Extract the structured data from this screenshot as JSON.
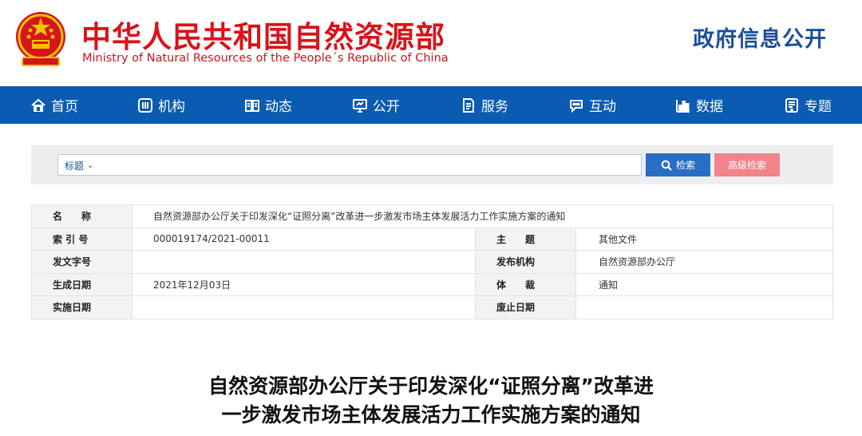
{
  "header": {
    "title": "中华人民共和国自然资源部",
    "subtitle": "Ministry of Natural Resources of the People´s Republic of China",
    "gov_info": "政府信息公开",
    "emblem_icon": "national-emblem-icon"
  },
  "nav": {
    "items": [
      {
        "label": "首页",
        "icon": "home-icon"
      },
      {
        "label": "机构",
        "icon": "org-icon"
      },
      {
        "label": "动态",
        "icon": "book-icon"
      },
      {
        "label": "公开",
        "icon": "monitor-icon"
      },
      {
        "label": "服务",
        "icon": "document-icon"
      },
      {
        "label": "互动",
        "icon": "chat-icon"
      },
      {
        "label": "数据",
        "icon": "bar-chart-icon"
      },
      {
        "label": "专题",
        "icon": "tablet-icon"
      }
    ]
  },
  "search": {
    "type_label": "标题",
    "placeholder": "",
    "search_button": "检索",
    "advanced_button": "高级检索"
  },
  "info": {
    "name_label": "名　　称",
    "name_value": "自然资源部办公厅关于印发深化“证照分离”改革进一步激发市场主体发展活力工作实施方案的通知",
    "index_label": "索 引 号",
    "index_value": "000019174/2021-00011",
    "topic_label": "主　　题",
    "topic_value": "其他文件",
    "doc_no_label": "发文字号",
    "doc_no_value": "",
    "issuer_label": "发布机构",
    "issuer_value": "自然资源部办公厅",
    "date_label": "生成日期",
    "date_value": "2021年12月03日",
    "genre_label": "体　　裁",
    "genre_value": "通知",
    "effective_label": "实施日期",
    "effective_value": "",
    "expire_label": "废止日期",
    "expire_value": ""
  },
  "article": {
    "title_line1": "自然资源部办公厅关于印发深化“证照分离”改革进",
    "title_line2": "一步激发市场主体发展活力工作实施方案的通知"
  },
  "colors": {
    "brand_red": "#d7141a",
    "nav_blue": "#0a5bb1",
    "gov_blue": "#1a4f9c",
    "search_blue": "#2a6dc5",
    "advanced_pink": "#f2838b"
  }
}
